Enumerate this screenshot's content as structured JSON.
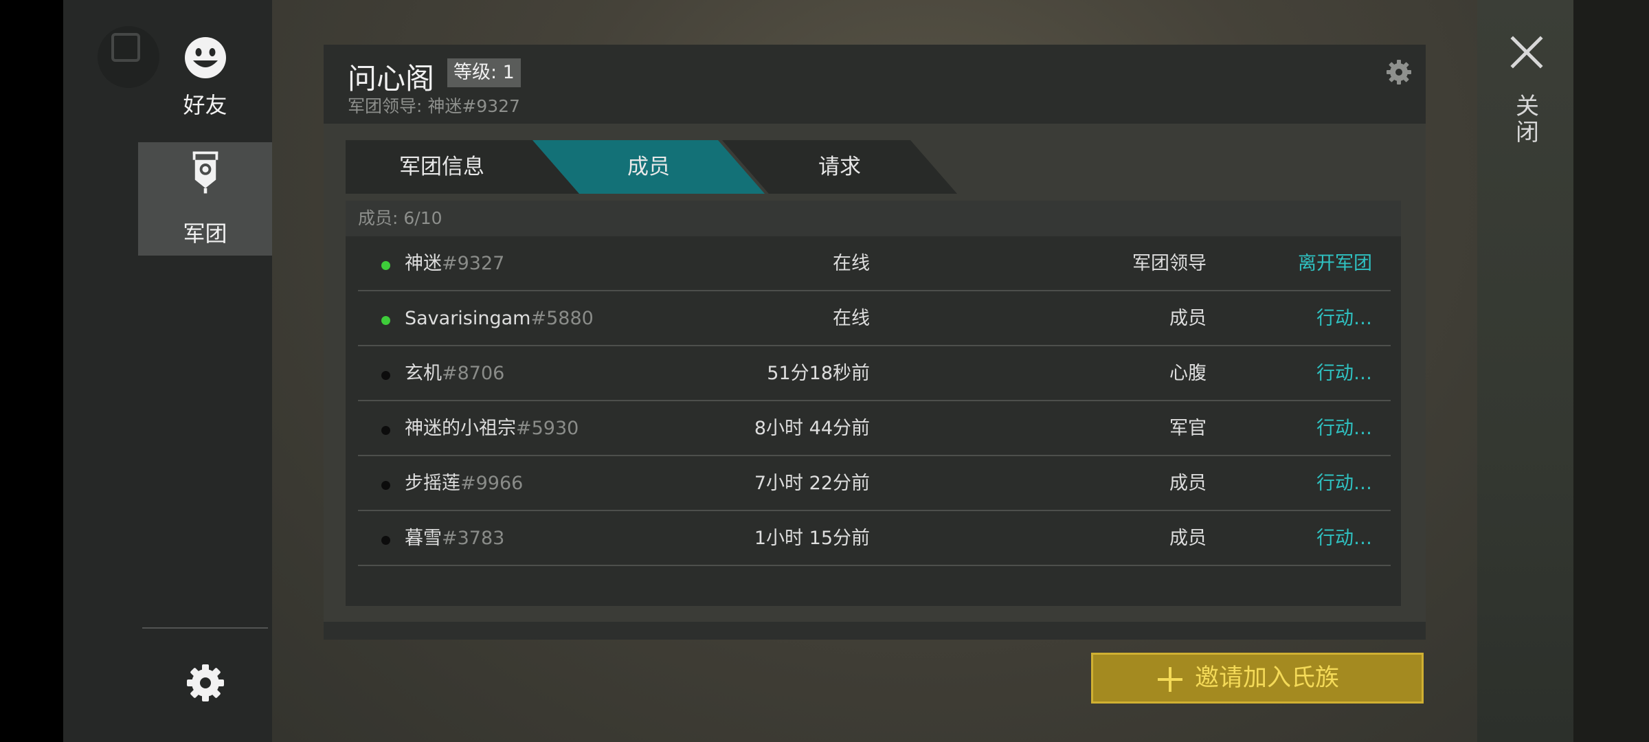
{
  "sidebar": {
    "friends_label": "好友",
    "clan_label": "军团"
  },
  "panel": {
    "clan_name": "问心阁",
    "level_badge": "等级: 1",
    "leader_line": "军团领导: 神迷#9327"
  },
  "tabs": [
    {
      "label": "军团信息",
      "active": false
    },
    {
      "label": "成员",
      "active": true
    },
    {
      "label": "请求",
      "active": false
    }
  ],
  "members": {
    "count_label": "成员: 6/10",
    "rows": [
      {
        "name": "神迷",
        "tag": "#9327",
        "status": "在线",
        "online": true,
        "role": "军团领导",
        "action": "离开军团"
      },
      {
        "name": "Savarisingam",
        "tag": "#5880",
        "status": "在线",
        "online": true,
        "role": "成员",
        "action": "行动…"
      },
      {
        "name": "玄机",
        "tag": "#8706",
        "status": "51分18秒前",
        "online": false,
        "role": "心腹",
        "action": "行动…"
      },
      {
        "name": "神迷的小祖宗",
        "tag": "#5930",
        "status": "8小时 44分前",
        "online": false,
        "role": "军官",
        "action": "行动…"
      },
      {
        "name": "步摇莲",
        "tag": "#9966",
        "status": "7小时 22分前",
        "online": false,
        "role": "成员",
        "action": "行动…"
      },
      {
        "name": "暮雪",
        "tag": "#3783",
        "status": "1小时 15分前",
        "online": false,
        "role": "成员",
        "action": "行动…"
      }
    ]
  },
  "invite_button": {
    "label": "邀请加入氏族"
  },
  "close": {
    "label": "关闭"
  },
  "colors": {
    "accent_teal": "#137177",
    "action_link": "#2fc2c2",
    "online_green": "#3ecc3a",
    "invite_gold": "#a48a20"
  }
}
